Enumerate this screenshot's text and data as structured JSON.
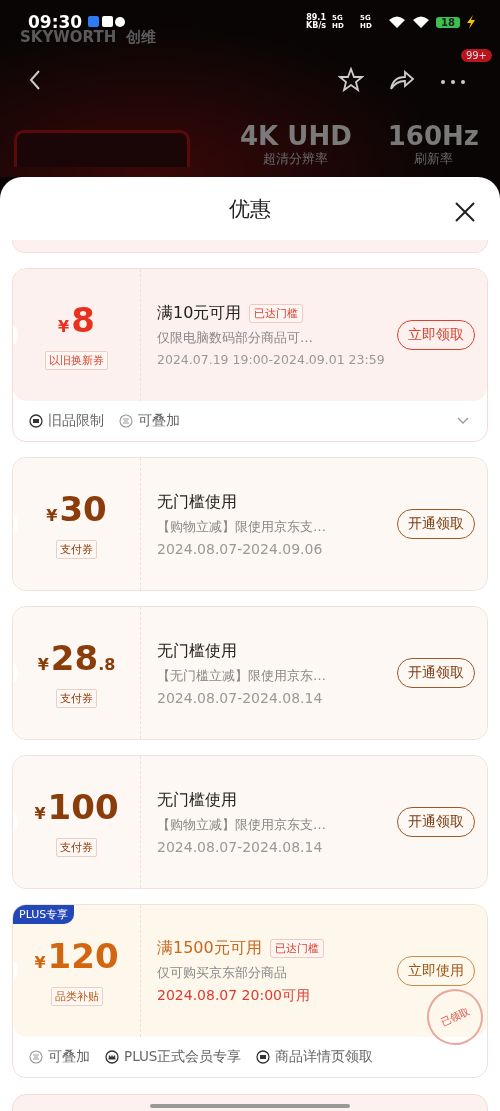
{
  "status_bar": {
    "time": "09:30",
    "net_speed": "89.1",
    "net_unit": "KB/s",
    "sim_1": "5G HD",
    "sim_2": "5G HD",
    "battery": "18"
  },
  "header": {
    "brand": "SKYWORTH",
    "brand_cn": "创维",
    "badge": "99+",
    "specs": [
      {
        "value": "4K UHD",
        "label": "超清分辨率"
      },
      {
        "value": "160Hz",
        "label": "刷新率"
      }
    ]
  },
  "sheet": {
    "title": "优惠"
  },
  "coupons": [
    {
      "kind": "tradein",
      "currency": "¥",
      "amount": "8",
      "type_tag": "以旧换新券",
      "title": "满10元可用",
      "threshold_tag": "已达门槛",
      "description": "仅限电脑数码部分商品可…",
      "date": "2024.07.19 19:00-2024.09.01 23:59",
      "date_highlight": false,
      "button": "立即领取",
      "footer": [
        {
          "kind": "box",
          "text": "旧品限制"
        },
        {
          "kind": "stack",
          "text": "可叠加"
        }
      ],
      "expandable": true
    },
    {
      "kind": "payment",
      "currency": "¥",
      "amount": "30",
      "type_tag": "支付券",
      "title": "无门槛使用",
      "description": "【购物立减】限使用京东支…",
      "date": "2024.08.07-2024.09.06",
      "date_highlight": false,
      "button": "开通领取"
    },
    {
      "kind": "payment",
      "currency": "¥",
      "amount": "28",
      "decimal": ".8",
      "type_tag": "支付券",
      "title": "无门槛使用",
      "description": "【无门槛立减】限使用京东…",
      "date": "2024.08.07-2024.08.14",
      "date_highlight": false,
      "button": "开通领取"
    },
    {
      "kind": "payment",
      "currency": "¥",
      "amount": "100",
      "type_tag": "支付券",
      "title": "无门槛使用",
      "description": "【购物立减】限使用京东支…",
      "date": "2024.08.07-2024.08.14",
      "date_highlight": false,
      "button": "开通领取"
    },
    {
      "kind": "subsidy",
      "ribbon": "PLUS专享",
      "currency": "¥",
      "amount": "120",
      "type_tag": "品类补贴",
      "title": "满1500元可用",
      "threshold_tag": "已达门槛",
      "description": "仅可购买京东部分商品",
      "date": "2024.08.07 20:00可用",
      "date_highlight": true,
      "button": "立即使用",
      "stamp": "已领取",
      "footer": [
        {
          "kind": "stack",
          "text": "可叠加"
        },
        {
          "kind": "crown",
          "text": "PLUS正式会员专享"
        },
        {
          "kind": "box",
          "text": "商品详情页领取"
        }
      ]
    }
  ]
}
